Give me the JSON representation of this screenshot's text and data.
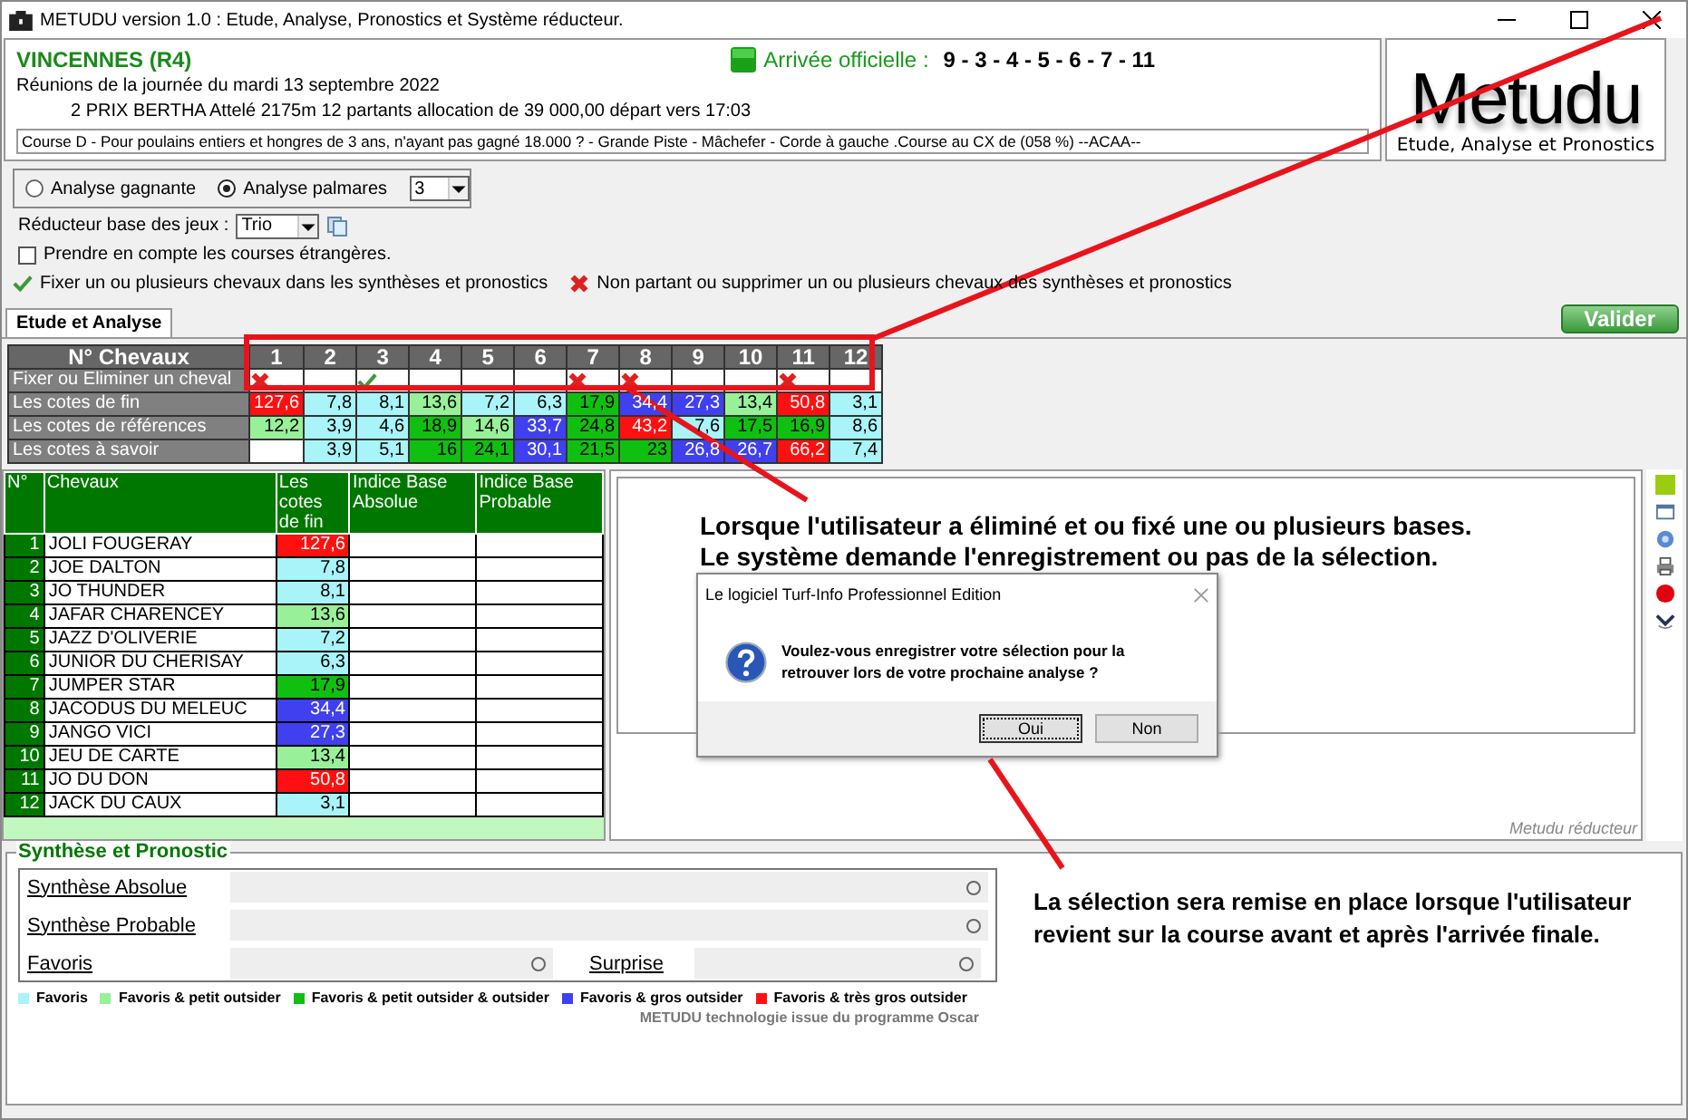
{
  "window": {
    "title": "METUDU version 1.0  : Etude, Analyse,  Pronostics et Système réducteur."
  },
  "race": {
    "venue": "VINCENNES (R4)",
    "date_line": "Réunions de la journée du mardi 13 septembre 2022",
    "race_line": "2 PRIX BERTHA Attelé 2175m 12 partants allocation de 39 000,00 départ vers 17:03",
    "conditions": "Course D - Pour poulains entiers et hongres de 3 ans, n'ayant pas gagné 18.000 ? - Grande Piste - Mâchefer - Corde à gauche .Course au CX de (058 %)  --ACAA--",
    "arrival_label": "Arrivée officielle :",
    "arrival": "9 - 3 - 4 - 5 - 6 - 7 - 11"
  },
  "logo": {
    "title": "Metudu",
    "subtitle": "Etude, Analyse et Pronostics"
  },
  "options": {
    "analysis": [
      {
        "label": "Analyse gagnante",
        "selected": false
      },
      {
        "label": "Analyse palmares",
        "selected": true
      }
    ],
    "palmares_count": "3",
    "reducer_label": "Réducteur base des jeux :",
    "reducer_value": "Trio",
    "foreign": {
      "label": "Prendre en compte les courses étrangères.",
      "checked": false
    },
    "fix_hint": "Fixer un ou plusieurs chevaux dans les synthèses et pronostics",
    "remove_hint": "Non partant ou supprimer un ou plusieurs chevaux des synthèses et pronostics"
  },
  "tabs": [
    {
      "label": "Etude et Analyse",
      "selected": true
    }
  ],
  "validate_button": "Valider",
  "grid": {
    "header": "N° Chevaux",
    "numbers": [
      "1",
      "2",
      "3",
      "4",
      "5",
      "6",
      "7",
      "8",
      "9",
      "10",
      "11",
      "12"
    ],
    "fix_row": {
      "label": "Fixer ou Eliminer un cheval",
      "marks": [
        {
          "eliminated": true,
          "fixed": false
        },
        {
          "eliminated": false,
          "fixed": false
        },
        {
          "eliminated": false,
          "fixed": true
        },
        {
          "eliminated": false,
          "fixed": false
        },
        {
          "eliminated": false,
          "fixed": false
        },
        {
          "eliminated": false,
          "fixed": false
        },
        {
          "eliminated": true,
          "fixed": false
        },
        {
          "eliminated": true,
          "fixed": false
        },
        {
          "eliminated": false,
          "fixed": false
        },
        {
          "eliminated": false,
          "fixed": false
        },
        {
          "eliminated": true,
          "fixed": false
        },
        {
          "eliminated": false,
          "fixed": false
        }
      ]
    },
    "rows": [
      {
        "label": "Les cotes de fin",
        "cells": [
          {
            "value": "127,6",
            "color": "#ff1010"
          },
          {
            "value": "7,8",
            "color": "#a8f4f8"
          },
          {
            "value": "8,1",
            "color": "#a8f4f8"
          },
          {
            "value": "13,6",
            "color": "#98f098"
          },
          {
            "value": "7,2",
            "color": "#a8f4f8"
          },
          {
            "value": "6,3",
            "color": "#a8f4f8"
          },
          {
            "value": "17,9",
            "color": "#10c010"
          },
          {
            "value": "34,4",
            "color": "#4040f0"
          },
          {
            "value": "27,3",
            "color": "#4040f0"
          },
          {
            "value": "13,4",
            "color": "#98f098"
          },
          {
            "value": "50,8",
            "color": "#ff1010"
          },
          {
            "value": "3,1",
            "color": "#a8f4f8"
          }
        ]
      },
      {
        "label": "Les cotes de références",
        "cells": [
          {
            "value": "12,2",
            "color": "#98f098"
          },
          {
            "value": "3,9",
            "color": "#a8f4f8"
          },
          {
            "value": "4,6",
            "color": "#a8f4f8"
          },
          {
            "value": "18,9",
            "color": "#10c010"
          },
          {
            "value": "14,6",
            "color": "#98f098"
          },
          {
            "value": "33,7",
            "color": "#4040f0"
          },
          {
            "value": "24,8",
            "color": "#10c010"
          },
          {
            "value": "43,2",
            "color": "#ff1010"
          },
          {
            "value": "7,6",
            "color": "#a8f4f8"
          },
          {
            "value": "17,5",
            "color": "#10c010"
          },
          {
            "value": "16,9",
            "color": "#10c010"
          },
          {
            "value": "8,6",
            "color": "#a8f4f8"
          }
        ]
      },
      {
        "label": "Les cotes à savoir",
        "cells": [
          {
            "color": "#ffffff"
          },
          {
            "value": "3,9",
            "color": "#a8f4f8"
          },
          {
            "value": "5,1",
            "color": "#a8f4f8"
          },
          {
            "value": "16",
            "color": "#10c010"
          },
          {
            "value": "24,1",
            "color": "#10c010"
          },
          {
            "value": "30,1",
            "color": "#4040f0"
          },
          {
            "value": "21,5",
            "color": "#10c010"
          },
          {
            "value": "23",
            "color": "#10c010"
          },
          {
            "value": "26,8",
            "color": "#4040f0"
          },
          {
            "value": "26,7",
            "color": "#4040f0"
          },
          {
            "value": "66,2",
            "color": "#ff1010"
          },
          {
            "value": "7,4",
            "color": "#a8f4f8"
          }
        ]
      }
    ]
  },
  "horses": {
    "columns": [
      "N°",
      "Chevaux",
      "Les cotes de fin",
      "Indice Base Absolue",
      "Indice Base Probable"
    ],
    "rows": [
      {
        "num": "1",
        "name": "JOLI FOUGERAY",
        "odds": "127,6",
        "color": "#ff1010"
      },
      {
        "num": "2",
        "name": "JOE DALTON",
        "odds": "7,8",
        "color": "#a8f4f8"
      },
      {
        "num": "3",
        "name": "JO THUNDER",
        "odds": "8,1",
        "color": "#a8f4f8"
      },
      {
        "num": "4",
        "name": "JAFAR CHARENCEY",
        "odds": "13,6",
        "color": "#98f098"
      },
      {
        "num": "5",
        "name": "JAZZ D'OLIVERIE",
        "odds": "7,2",
        "color": "#a8f4f8"
      },
      {
        "num": "6",
        "name": "JUNIOR DU CHERISAY",
        "odds": "6,3",
        "color": "#a8f4f8"
      },
      {
        "num": "7",
        "name": "JUMPER STAR",
        "odds": "17,9",
        "color": "#10c010"
      },
      {
        "num": "8",
        "name": "JACODUS DU MELEUC",
        "odds": "34,4",
        "color": "#4040f0"
      },
      {
        "num": "9",
        "name": "JANGO VICI",
        "odds": "27,3",
        "color": "#4040f0"
      },
      {
        "num": "10",
        "name": "JEU DE CARTE",
        "odds": "13,4",
        "color": "#98f098"
      },
      {
        "num": "11",
        "name": "JO DU DON",
        "odds": "50,8",
        "color": "#ff1010"
      },
      {
        "num": "12",
        "name": "JACK DU CAUX",
        "odds": "3,1",
        "color": "#a8f4f8"
      }
    ]
  },
  "note_top": [
    "Lorsque l'utilisateur a éliminé et ou fixé une ou plusieurs bases.",
    "Le système demande l'enregistrement ou pas de la sélection."
  ],
  "dialog": {
    "title": "Le logiciel Turf-Info Professionnel Edition",
    "message": "Voulez-vous enregistrer votre sélection pour la retrouver lors de votre prochaine analyse ?",
    "buttons": [
      {
        "label": "Oui",
        "selected": true
      },
      {
        "label": "Non",
        "selected": false
      }
    ]
  },
  "panel_caption": "Metudu réducteur",
  "synthesis": {
    "title": "Synthèse et Pronostic",
    "fields": [
      {
        "label": "Synthèse Absolue"
      },
      {
        "label": "Synthèse Probable"
      }
    ],
    "pair": [
      {
        "label": "Favoris"
      },
      {
        "label": "Surprise"
      }
    ]
  },
  "legend": [
    {
      "label": "Favoris",
      "color": "#a8f4f8"
    },
    {
      "label": "Favoris & petit outsider",
      "color": "#98f098"
    },
    {
      "label": "Favoris & petit outsider & outsider",
      "color": "#10c010"
    },
    {
      "label": "Favoris & gros outsider",
      "color": "#4040f0"
    },
    {
      "label": "Favoris & très gros outsider",
      "color": "#ff1010"
    }
  ],
  "credit": "METUDU technologie issue du programme Oscar",
  "note_bottom": "La sélection sera remise en place lorsque l'utilisateur revient sur la course avant et après l'arrivée finale."
}
